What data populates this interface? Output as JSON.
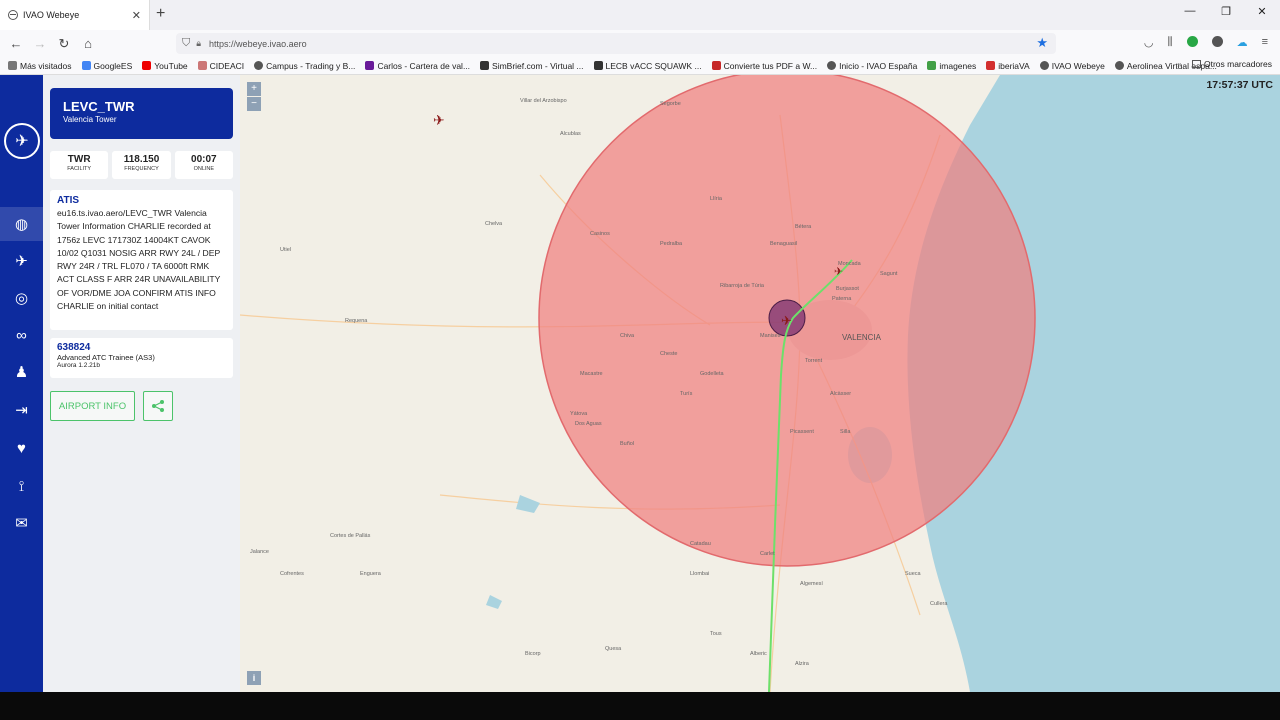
{
  "browser": {
    "tab_title": "IVAO Webeye",
    "url": "https://webeye.ivao.aero",
    "bookmarks": [
      {
        "label": "Más visitados",
        "color": "#777"
      },
      {
        "label": "GoogleES",
        "color": "#4285f4"
      },
      {
        "label": "YouTube",
        "color": "#e00"
      },
      {
        "label": "CIDEACI",
        "color": "#c77"
      },
      {
        "label": "Campus - Trading y B...",
        "color": "#555"
      },
      {
        "label": "Carlos - Cartera de val...",
        "color": "#6a1b9a"
      },
      {
        "label": "SimBrief.com - Virtual ...",
        "color": "#333"
      },
      {
        "label": "LECB vACC SQUAWK ...",
        "color": "#333"
      },
      {
        "label": "Convierte tus PDF a W...",
        "color": "#c62828"
      },
      {
        "label": "Inicio - IVAO España",
        "color": "#555"
      },
      {
        "label": "imagenes",
        "color": "#43a047"
      },
      {
        "label": "iberiaVA",
        "color": "#d32f2f"
      },
      {
        "label": "IVAO Webeye",
        "color": "#555"
      },
      {
        "label": "Aerolinea Virtual espa...",
        "color": "#555"
      }
    ],
    "other_bookmarks": "Otros marcadores"
  },
  "panel": {
    "callsign": "LEVC_TWR",
    "name": "Valencia Tower",
    "stats": [
      {
        "value": "TWR",
        "label": "FACILITY"
      },
      {
        "value": "118.150",
        "label": "FREQUENCY"
      },
      {
        "value": "00:07",
        "label": "ONLINE"
      }
    ],
    "atis_title": "ATIS",
    "atis_text": "eu16.ts.ivao.aero/LEVC_TWR Valencia Tower Information CHARLIE recorded at 1756z LEVC 171730Z 14004KT CAVOK 10/02 Q1031 NOSIG ARR RWY 24L / DEP RWY 24R / TRL FL070 / TA 6000ft RMK ACT CLASS F ARR 24R UNAVAILABILITY OF VOR/DME JOA CONFIRM ATIS INFO CHARLIE on initial contact",
    "user_id": "638824",
    "user_rating": "Advanced ATC Trainee (AS3)",
    "software": "Aurora 1.2.21b",
    "airport_info_label": "AIRPORT INFO"
  },
  "map": {
    "utc_time": "17:57:37 UTC",
    "zoom_in": "+",
    "zoom_out": "−",
    "info": "i",
    "city_label": "VALENCIA",
    "place_labels": [
      "Requena",
      "Llíria",
      "Paterna",
      "Bétera",
      "Sagunt",
      "Sueca",
      "Alzira",
      "Picassent",
      "Torrent",
      "Buñol",
      "Chiva",
      "Cheste",
      "Utiel",
      "Alcàsser",
      "Silla",
      "Manises",
      "Ribarroja de Túria",
      "Catadau",
      "Carlet",
      "Algemesí",
      "Llombai",
      "Cullera",
      "Moncada",
      "Burjassot",
      "Turís",
      "Godelleta",
      "Yátova",
      "Dos Aguas",
      "Macastre",
      "Chelva",
      "Casinos",
      "Pedralba",
      "Villar del Arzobispo",
      "Alcublas",
      "Segorbe",
      "Benaguasil",
      "Cortes de Pallás",
      "Jalance",
      "Cofrentes",
      "Tous",
      "Alberic",
      "Quesa",
      "Bicorp",
      "Enguera"
    ],
    "fir_color": "#f07f80",
    "route_color": "#6de06a",
    "ctr_color": "#7a3070"
  }
}
